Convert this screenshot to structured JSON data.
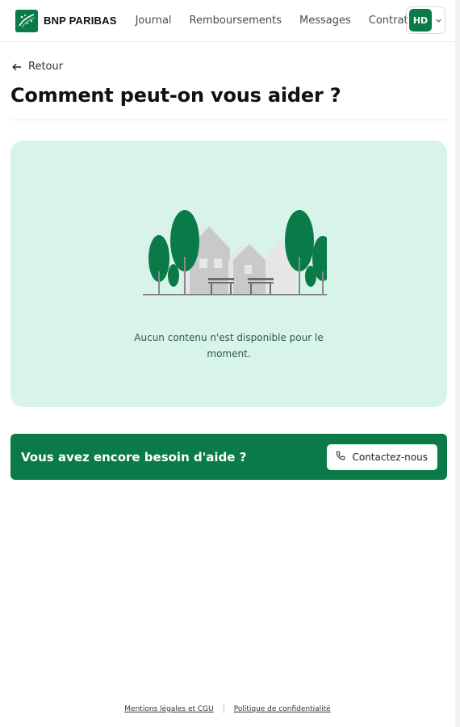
{
  "header": {
    "brand": "BNP PARIBAS",
    "nav": [
      "Journal",
      "Remboursements",
      "Messages",
      "Contrat"
    ],
    "user_initials": "HD"
  },
  "back_label": "Retour",
  "page_title": "Comment peut-on vous aider ?",
  "empty_state": {
    "message": "Aucun contenu n'est disponible pour le moment.",
    "illustration": "houses-trees-benches-illustration"
  },
  "help_banner": {
    "title": "Vous avez encore besoin d'aide ?",
    "contact_label": "Contactez-nous",
    "contact_icon": "phone-icon"
  },
  "footer": {
    "links": [
      "Mentions légales et CGU",
      "Politique de confidentialité"
    ]
  },
  "colors": {
    "brand_green": "#0a7a48",
    "card_mint": "#d8f3e9"
  }
}
